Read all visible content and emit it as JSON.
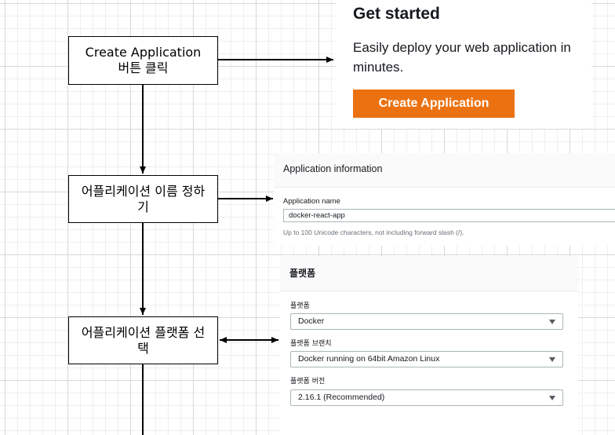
{
  "flow_steps": [
    {
      "line1": "Create Application",
      "line2": "버튼 클릭"
    },
    {
      "line1": "어플리케이션 이름 정하",
      "line2": "기"
    },
    {
      "line1": "어플리케이션 플랫폼 선",
      "line2": "택"
    }
  ],
  "get_started": {
    "title": "Get started",
    "description": "Easily deploy your web application in minutes.",
    "button_label": "Create Application",
    "button_color": "#ec7211"
  },
  "application_information": {
    "header": "Application information",
    "name_label": "Application name",
    "name_value": "docker-react-app",
    "hint": "Up to 100 Unicode characters, not including forward slash (/)."
  },
  "platform": {
    "header": "플랫폼",
    "platform_label": "플랫폼",
    "platform_value": "Docker",
    "branch_label": "플랫폼 브랜치",
    "branch_value": "Docker running on 64bit Amazon Linux",
    "version_label": "플랫폼 버전",
    "version_value": "2.16.1 (Recommended)",
    "caret_icon": "caret-down-icon"
  }
}
